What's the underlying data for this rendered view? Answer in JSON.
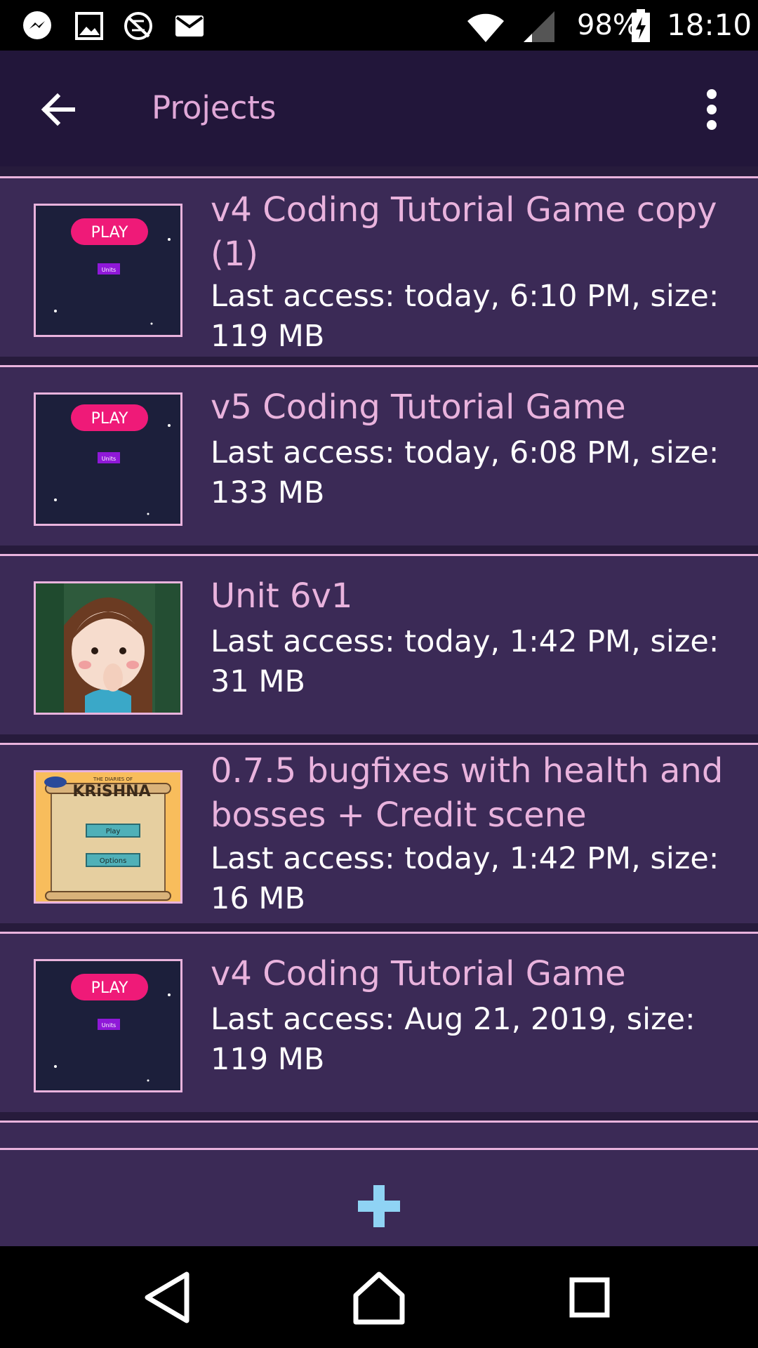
{
  "status_bar": {
    "battery": "98%",
    "time": "18:10",
    "icons": [
      "messenger-icon",
      "image-icon",
      "no-data-icon",
      "mail-icon",
      "wifi-icon",
      "signal-icon",
      "battery-charging-icon"
    ]
  },
  "app_bar": {
    "title": "Projects",
    "back_icon": "arrow-back-icon",
    "menu_icon": "more-vert-icon"
  },
  "projects": [
    {
      "title_line1": "v4 Coding Tutorial Game copy",
      "title_line2": "(1)",
      "meta_line1": "Last access: today, 6:10 PM, size:",
      "meta_line2": "119 MB",
      "thumbnail": "space-play-menu"
    },
    {
      "title_line1": "v5 Coding Tutorial Game",
      "title_line2": "",
      "meta_line1": "Last access: today, 6:08 PM, size:",
      "meta_line2": "133 MB",
      "thumbnail": "space-play-menu"
    },
    {
      "title_line1": "Unit 6v1",
      "title_line2": "",
      "meta_line1": "Last access: today, 1:42 PM, size:",
      "meta_line2": "31 MB",
      "thumbnail": "girl-character"
    },
    {
      "title_line1": "0.7.5  bugfixes with health and",
      "title_line2": "bosses + Credit scene",
      "meta_line1": "Last access: today, 1:42 PM, size:",
      "meta_line2": "16 MB",
      "thumbnail": "krishna-scroll"
    },
    {
      "title_line1": "v4 Coding Tutorial Game",
      "title_line2": "",
      "meta_line1": "Last access: Aug 21, 2019, size:",
      "meta_line2": "119 MB",
      "thumbnail": "space-play-menu"
    }
  ],
  "thumbnail_text": {
    "play": "PLAY",
    "units": "Units",
    "krishna_small": "THE DIARIES OF",
    "krishna_title": "KRiSHNA",
    "krishna_play": "Play",
    "krishna_options": "Options"
  },
  "bottom": {
    "add_icon": "plus-icon"
  },
  "colors": {
    "accent_pink": "#e9b3dd",
    "card_bg": "#3b2a56",
    "app_bar_bg": "#22163a",
    "add_button": "#8fd3f4"
  },
  "nav_bar": {
    "icons": [
      "nav-back-icon",
      "nav-home-icon",
      "nav-recents-icon"
    ]
  }
}
